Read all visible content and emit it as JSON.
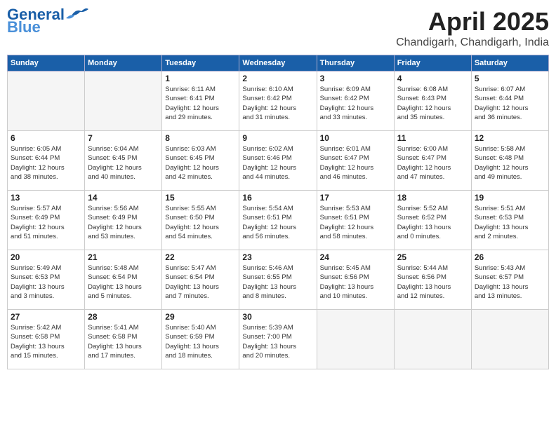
{
  "header": {
    "logo_line1": "General",
    "logo_line2": "Blue",
    "month": "April 2025",
    "location": "Chandigarh, Chandigarh, India"
  },
  "weekdays": [
    "Sunday",
    "Monday",
    "Tuesday",
    "Wednesday",
    "Thursday",
    "Friday",
    "Saturday"
  ],
  "weeks": [
    [
      {
        "day": "",
        "info": ""
      },
      {
        "day": "",
        "info": ""
      },
      {
        "day": "1",
        "info": "Sunrise: 6:11 AM\nSunset: 6:41 PM\nDaylight: 12 hours\nand 29 minutes."
      },
      {
        "day": "2",
        "info": "Sunrise: 6:10 AM\nSunset: 6:42 PM\nDaylight: 12 hours\nand 31 minutes."
      },
      {
        "day": "3",
        "info": "Sunrise: 6:09 AM\nSunset: 6:42 PM\nDaylight: 12 hours\nand 33 minutes."
      },
      {
        "day": "4",
        "info": "Sunrise: 6:08 AM\nSunset: 6:43 PM\nDaylight: 12 hours\nand 35 minutes."
      },
      {
        "day": "5",
        "info": "Sunrise: 6:07 AM\nSunset: 6:44 PM\nDaylight: 12 hours\nand 36 minutes."
      }
    ],
    [
      {
        "day": "6",
        "info": "Sunrise: 6:05 AM\nSunset: 6:44 PM\nDaylight: 12 hours\nand 38 minutes."
      },
      {
        "day": "7",
        "info": "Sunrise: 6:04 AM\nSunset: 6:45 PM\nDaylight: 12 hours\nand 40 minutes."
      },
      {
        "day": "8",
        "info": "Sunrise: 6:03 AM\nSunset: 6:45 PM\nDaylight: 12 hours\nand 42 minutes."
      },
      {
        "day": "9",
        "info": "Sunrise: 6:02 AM\nSunset: 6:46 PM\nDaylight: 12 hours\nand 44 minutes."
      },
      {
        "day": "10",
        "info": "Sunrise: 6:01 AM\nSunset: 6:47 PM\nDaylight: 12 hours\nand 46 minutes."
      },
      {
        "day": "11",
        "info": "Sunrise: 6:00 AM\nSunset: 6:47 PM\nDaylight: 12 hours\nand 47 minutes."
      },
      {
        "day": "12",
        "info": "Sunrise: 5:58 AM\nSunset: 6:48 PM\nDaylight: 12 hours\nand 49 minutes."
      }
    ],
    [
      {
        "day": "13",
        "info": "Sunrise: 5:57 AM\nSunset: 6:49 PM\nDaylight: 12 hours\nand 51 minutes."
      },
      {
        "day": "14",
        "info": "Sunrise: 5:56 AM\nSunset: 6:49 PM\nDaylight: 12 hours\nand 53 minutes."
      },
      {
        "day": "15",
        "info": "Sunrise: 5:55 AM\nSunset: 6:50 PM\nDaylight: 12 hours\nand 54 minutes."
      },
      {
        "day": "16",
        "info": "Sunrise: 5:54 AM\nSunset: 6:51 PM\nDaylight: 12 hours\nand 56 minutes."
      },
      {
        "day": "17",
        "info": "Sunrise: 5:53 AM\nSunset: 6:51 PM\nDaylight: 12 hours\nand 58 minutes."
      },
      {
        "day": "18",
        "info": "Sunrise: 5:52 AM\nSunset: 6:52 PM\nDaylight: 13 hours\nand 0 minutes."
      },
      {
        "day": "19",
        "info": "Sunrise: 5:51 AM\nSunset: 6:53 PM\nDaylight: 13 hours\nand 2 minutes."
      }
    ],
    [
      {
        "day": "20",
        "info": "Sunrise: 5:49 AM\nSunset: 6:53 PM\nDaylight: 13 hours\nand 3 minutes."
      },
      {
        "day": "21",
        "info": "Sunrise: 5:48 AM\nSunset: 6:54 PM\nDaylight: 13 hours\nand 5 minutes."
      },
      {
        "day": "22",
        "info": "Sunrise: 5:47 AM\nSunset: 6:54 PM\nDaylight: 13 hours\nand 7 minutes."
      },
      {
        "day": "23",
        "info": "Sunrise: 5:46 AM\nSunset: 6:55 PM\nDaylight: 13 hours\nand 8 minutes."
      },
      {
        "day": "24",
        "info": "Sunrise: 5:45 AM\nSunset: 6:56 PM\nDaylight: 13 hours\nand 10 minutes."
      },
      {
        "day": "25",
        "info": "Sunrise: 5:44 AM\nSunset: 6:56 PM\nDaylight: 13 hours\nand 12 minutes."
      },
      {
        "day": "26",
        "info": "Sunrise: 5:43 AM\nSunset: 6:57 PM\nDaylight: 13 hours\nand 13 minutes."
      }
    ],
    [
      {
        "day": "27",
        "info": "Sunrise: 5:42 AM\nSunset: 6:58 PM\nDaylight: 13 hours\nand 15 minutes."
      },
      {
        "day": "28",
        "info": "Sunrise: 5:41 AM\nSunset: 6:58 PM\nDaylight: 13 hours\nand 17 minutes."
      },
      {
        "day": "29",
        "info": "Sunrise: 5:40 AM\nSunset: 6:59 PM\nDaylight: 13 hours\nand 18 minutes."
      },
      {
        "day": "30",
        "info": "Sunrise: 5:39 AM\nSunset: 7:00 PM\nDaylight: 13 hours\nand 20 minutes."
      },
      {
        "day": "",
        "info": ""
      },
      {
        "day": "",
        "info": ""
      },
      {
        "day": "",
        "info": ""
      }
    ]
  ]
}
